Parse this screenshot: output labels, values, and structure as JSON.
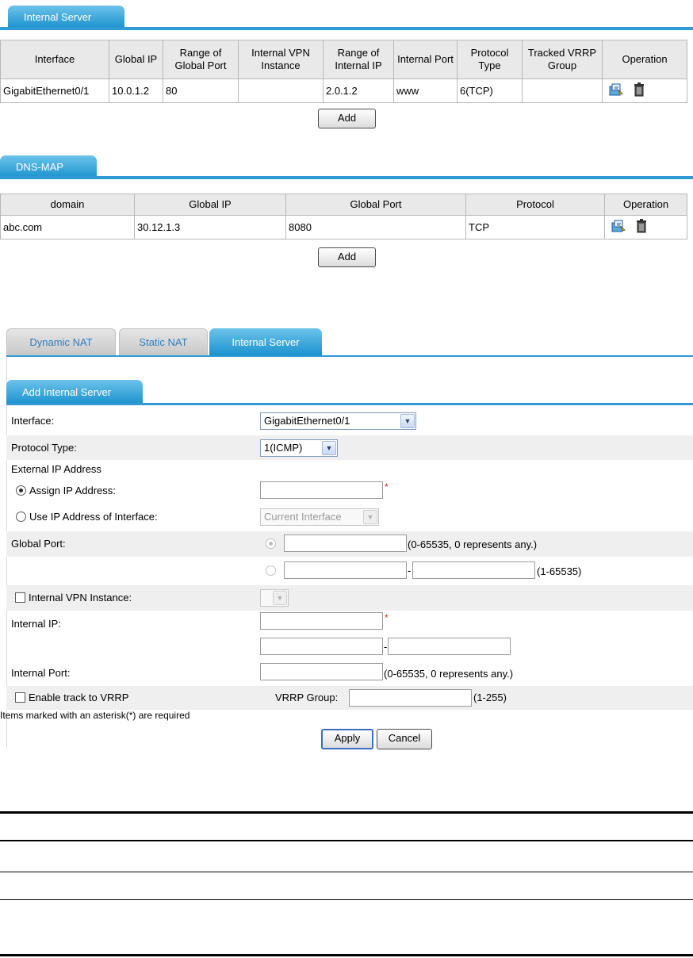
{
  "internal_server_panel": {
    "tab_label": "Internal Server",
    "columns": [
      "Interface",
      "Global IP",
      "Range of Global Port",
      "Internal VPN Instance",
      "Range of Internal IP",
      "Internal Port",
      "Protocol Type",
      "Tracked VRRP Group",
      "Operation"
    ],
    "rows": [
      {
        "interface": "GigabitEthernet0/1",
        "global_ip": "10.0.1.2",
        "global_port": "80",
        "vpn": "",
        "internal_ip": "2.0.1.2",
        "internal_port": "www",
        "protocol": "6(TCP)",
        "vrrp": ""
      }
    ],
    "add_label": "Add"
  },
  "dns_map_panel": {
    "tab_label": "DNS-MAP",
    "columns": [
      "domain",
      "Global IP",
      "Global Port",
      "Protocol",
      "Operation"
    ],
    "rows": [
      {
        "domain": "abc.com",
        "global_ip": "30.12.1.3",
        "global_port": "8080",
        "protocol": "TCP"
      }
    ],
    "add_label": "Add"
  },
  "nat_tabs": [
    "Dynamic NAT",
    "Static NAT",
    "Internal Server"
  ],
  "nat_active_tab": "Internal Server",
  "add_form": {
    "tab_label": "Add Internal Server",
    "interface_label": "Interface:",
    "interface_value": "GigabitEthernet0/1",
    "protocol_label": "Protocol Type:",
    "protocol_value": "1(ICMP)",
    "external_ip_label": "External IP Address",
    "assign_ip_label": "Assign IP Address:",
    "use_if_ip_label": "Use IP Address of Interface:",
    "use_if_value": "Current Interface",
    "global_port_label": "Global Port:",
    "global_port_hint": "(0-65535, 0 represents any.)",
    "global_port_range_hint": "(1-65535)",
    "range_dash": "-",
    "vpn_label": "Internal VPN Instance:",
    "internal_ip_label": "Internal IP:",
    "internal_port_label": "Internal Port:",
    "internal_port_hint": "(0-65535, 0 represents any.)",
    "vrrp_label": "Enable track to VRRP",
    "vrrp_group_label": "VRRP Group:",
    "vrrp_group_hint": "(1-255)",
    "required_note": "Items marked with an asterisk(*) are required",
    "required_mark": "*",
    "apply_label": "Apply",
    "cancel_label": "Cancel"
  },
  "colors": {
    "tab_blue": "#1790cd",
    "inactive_tab_text": "#2f7fbe",
    "required": "#e02020"
  },
  "icons": [
    "modify-icon",
    "delete-icon",
    "chevron-down-icon"
  ]
}
